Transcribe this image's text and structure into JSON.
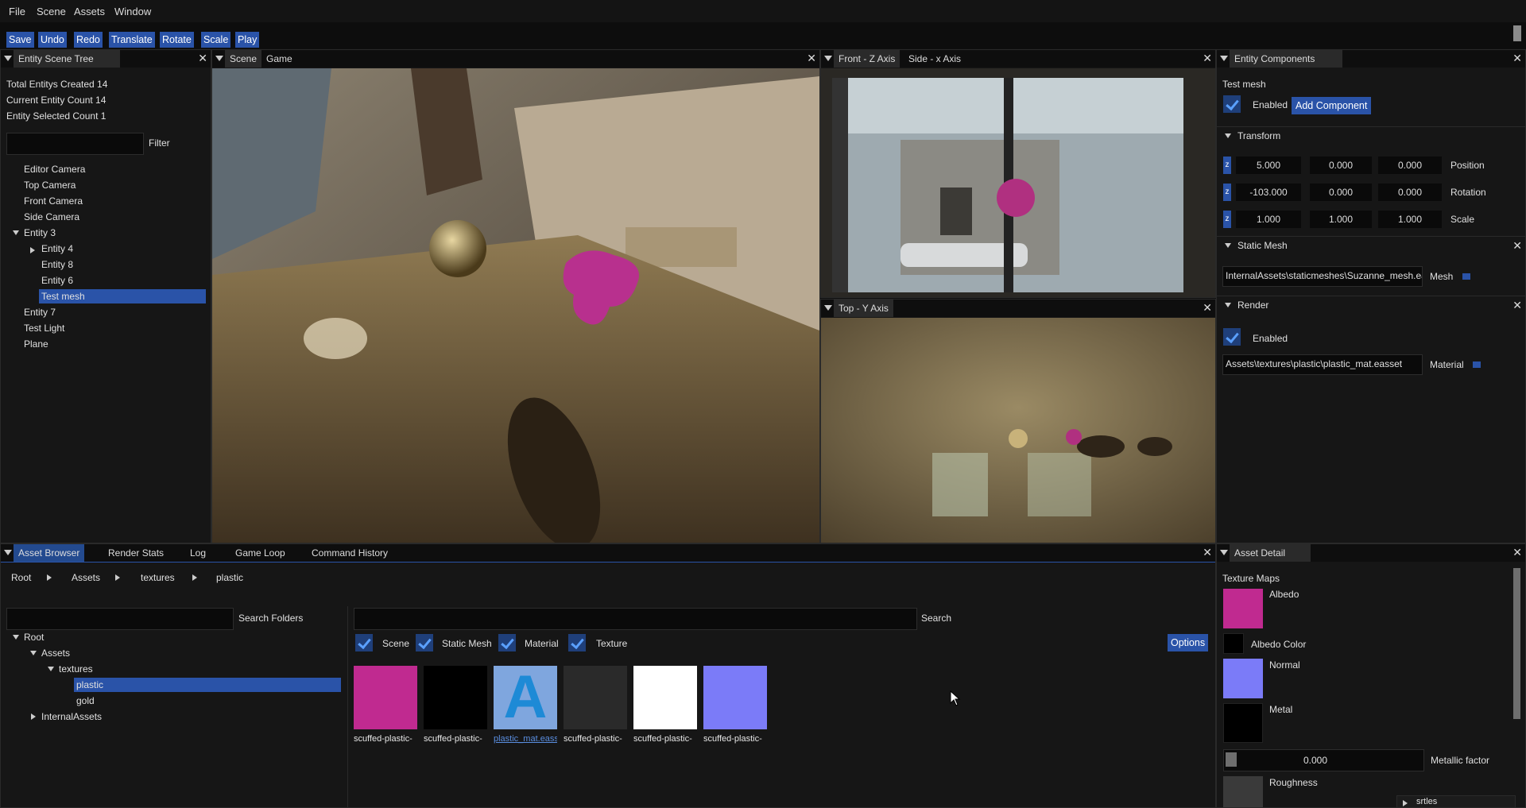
{
  "menu": {
    "items": [
      "File",
      "Scene",
      "Assets",
      "Window"
    ]
  },
  "toolbar": {
    "buttons": [
      "Save",
      "Undo",
      "Redo",
      "Translate",
      "Rotate",
      "Scale",
      "Play"
    ]
  },
  "scene_tree": {
    "tab": "Entity Scene Tree",
    "stats": [
      "Total Entitys Created 14",
      "Current Entity Count 14",
      "Entity Selected Count 1"
    ],
    "filter_label": "Filter",
    "items": [
      "Editor Camera",
      "Top Camera",
      "Front Camera",
      "Side Camera",
      "Entity 3",
      "Entity 4",
      "Entity 8",
      "Entity 6",
      "Test mesh",
      "Entity 7",
      "Test Light",
      "Plane"
    ],
    "selected": "Test mesh"
  },
  "viewport_main": {
    "tabs": [
      "Scene",
      "Game"
    ]
  },
  "viewport_front": {
    "tabs": [
      "Front - Z Axis",
      "Side - x Axis"
    ]
  },
  "viewport_top": {
    "tabs": [
      "Top - Y Axis"
    ]
  },
  "components": {
    "tab": "Entity Components",
    "entity_name": "Test mesh",
    "enabled_label": "Enabled",
    "add_component": "Add Component",
    "transform": {
      "title": "Transform",
      "badge": "z",
      "position": {
        "label": "Position",
        "values": [
          "5.000",
          "0.000",
          "0.000"
        ]
      },
      "rotation": {
        "label": "Rotation",
        "values": [
          "-103.000",
          "0.000",
          "0.000"
        ]
      },
      "scale": {
        "label": "Scale",
        "values": [
          "1.000",
          "1.000",
          "1.000"
        ]
      }
    },
    "static_mesh": {
      "title": "Static Mesh",
      "path": "InternalAssets\\staticmeshes\\Suzanne_mesh.eass",
      "label": "Mesh"
    },
    "render": {
      "title": "Render",
      "enabled_label": "Enabled",
      "path": "Assets\\textures\\plastic\\plastic_mat.easset",
      "label": "Material"
    }
  },
  "bottom_tabs": [
    "Asset Browser",
    "Render Stats",
    "Log",
    "Game Loop",
    "Command History"
  ],
  "asset_browser": {
    "breadcrumb": [
      "Root",
      "Assets",
      "textures",
      "plastic"
    ],
    "search_folders_label": "Search Folders",
    "search_label": "Search",
    "filters": [
      "Scene",
      "Static Mesh",
      "Material",
      "Texture"
    ],
    "options_label": "Options",
    "folders": {
      "root": "Root",
      "assets": "Assets",
      "textures": "textures",
      "plastic": "plastic",
      "gold": "gold",
      "internal": "InternalAssets"
    },
    "assets": [
      {
        "name": "scuffed-plastic-",
        "color": "#c02a90"
      },
      {
        "name": "scuffed-plastic-",
        "color": "#000000"
      },
      {
        "name": "plastic_mat.eass",
        "color": "#7fa6de",
        "glyph": "A"
      },
      {
        "name": "scuffed-plastic-",
        "color": "#2a2a2a"
      },
      {
        "name": "scuffed-plastic-",
        "color": "#ffffff"
      },
      {
        "name": "scuffed-plastic-",
        "color": "#7b7bf8"
      }
    ]
  },
  "asset_detail": {
    "tab": "Asset Detail",
    "heading": "Texture Maps",
    "albedo": "Albedo",
    "albedo_color": "Albedo Color",
    "normal": "Normal",
    "metal": "Metal",
    "metallic_value": "0.000",
    "metallic_label": "Metallic factor",
    "roughness": "Roughness",
    "overflow_item": "srtles"
  },
  "colors": {
    "accent": "#2a53a8",
    "albedo": "#c02a90",
    "normal": "#7b7bf8"
  }
}
